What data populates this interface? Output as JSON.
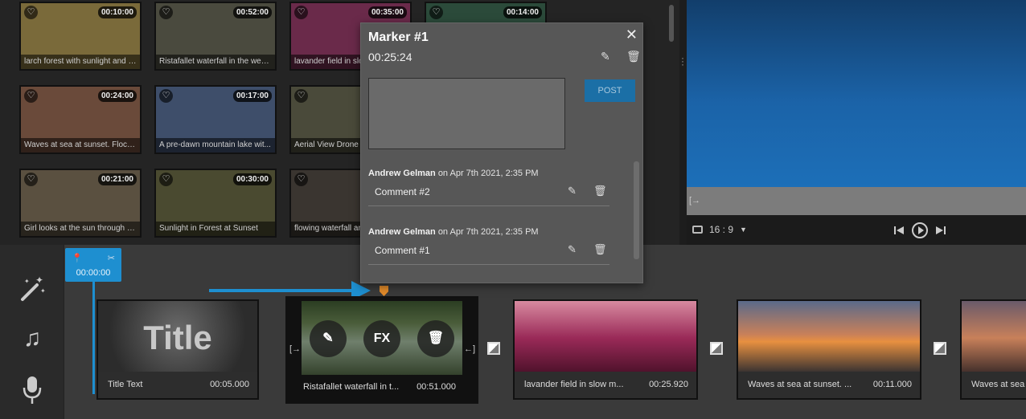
{
  "library": {
    "items": [
      {
        "caption": "larch forest with sunlight and s...",
        "duration": "00:10:00",
        "color": "#7a6a3a"
      },
      {
        "caption": "Ristafallet waterfall in the west...",
        "duration": "00:52:00",
        "color": "#4a4a3e"
      },
      {
        "caption": "lavander field in slo",
        "duration": "00:35:00",
        "color": "#6a2a4a"
      },
      {
        "caption": "",
        "duration": "00:14:00",
        "color": "#2b4a3a"
      },
      {
        "caption": "Waves at sea at sunset. Flocks ...",
        "duration": "00:24:00",
        "color": "#6a4a3a"
      },
      {
        "caption": "A pre-dawn mountain lake wit...",
        "duration": "00:17:00",
        "color": "#3e4e6a"
      },
      {
        "caption": "Aerial View Drone",
        "duration": "",
        "color": "#4a4a3a"
      },
      {
        "caption": "Girl looks at the sun through h...",
        "duration": "00:21:00",
        "color": "#5a5040"
      },
      {
        "caption": "Sunlight in Forest at Sunset",
        "duration": "00:30:00",
        "color": "#4a4a30"
      },
      {
        "caption": "flowing waterfall an",
        "duration": "",
        "color": "#3a3530"
      }
    ]
  },
  "preview": {
    "aspect_ratio": "16 : 9",
    "accent": "#1e8fd0"
  },
  "playhead": {
    "time": "00:00:00"
  },
  "popup": {
    "title": "Marker #1",
    "time": "00:25:24",
    "textarea_value": "",
    "post_label": "POST",
    "comments": [
      {
        "author": "Andrew Gelman",
        "date": "on Apr 7th 2021, 2:35 PM",
        "text": "Comment #2"
      },
      {
        "author": "Andrew Gelman",
        "date": "on Apr 7th 2021, 2:35 PM",
        "text": "Comment #1"
      }
    ]
  },
  "timeline": {
    "title_clip": {
      "preview_text": "Title",
      "name": "Title Text",
      "duration": "00:05.000"
    },
    "selected_clip": {
      "name": "Ristafallet waterfall in t...",
      "duration": "00:51.000",
      "fx_label": "FX"
    },
    "clips": [
      {
        "name": "lavander field in slow m...",
        "duration": "00:25.920",
        "color": "#7a2a48"
      },
      {
        "name": "Waves at sea at sunset. ...",
        "duration": "00:11.000",
        "color": "#8a5a4a"
      },
      {
        "name": "Waves at sea",
        "duration": "",
        "color": "#7a5040"
      }
    ]
  }
}
